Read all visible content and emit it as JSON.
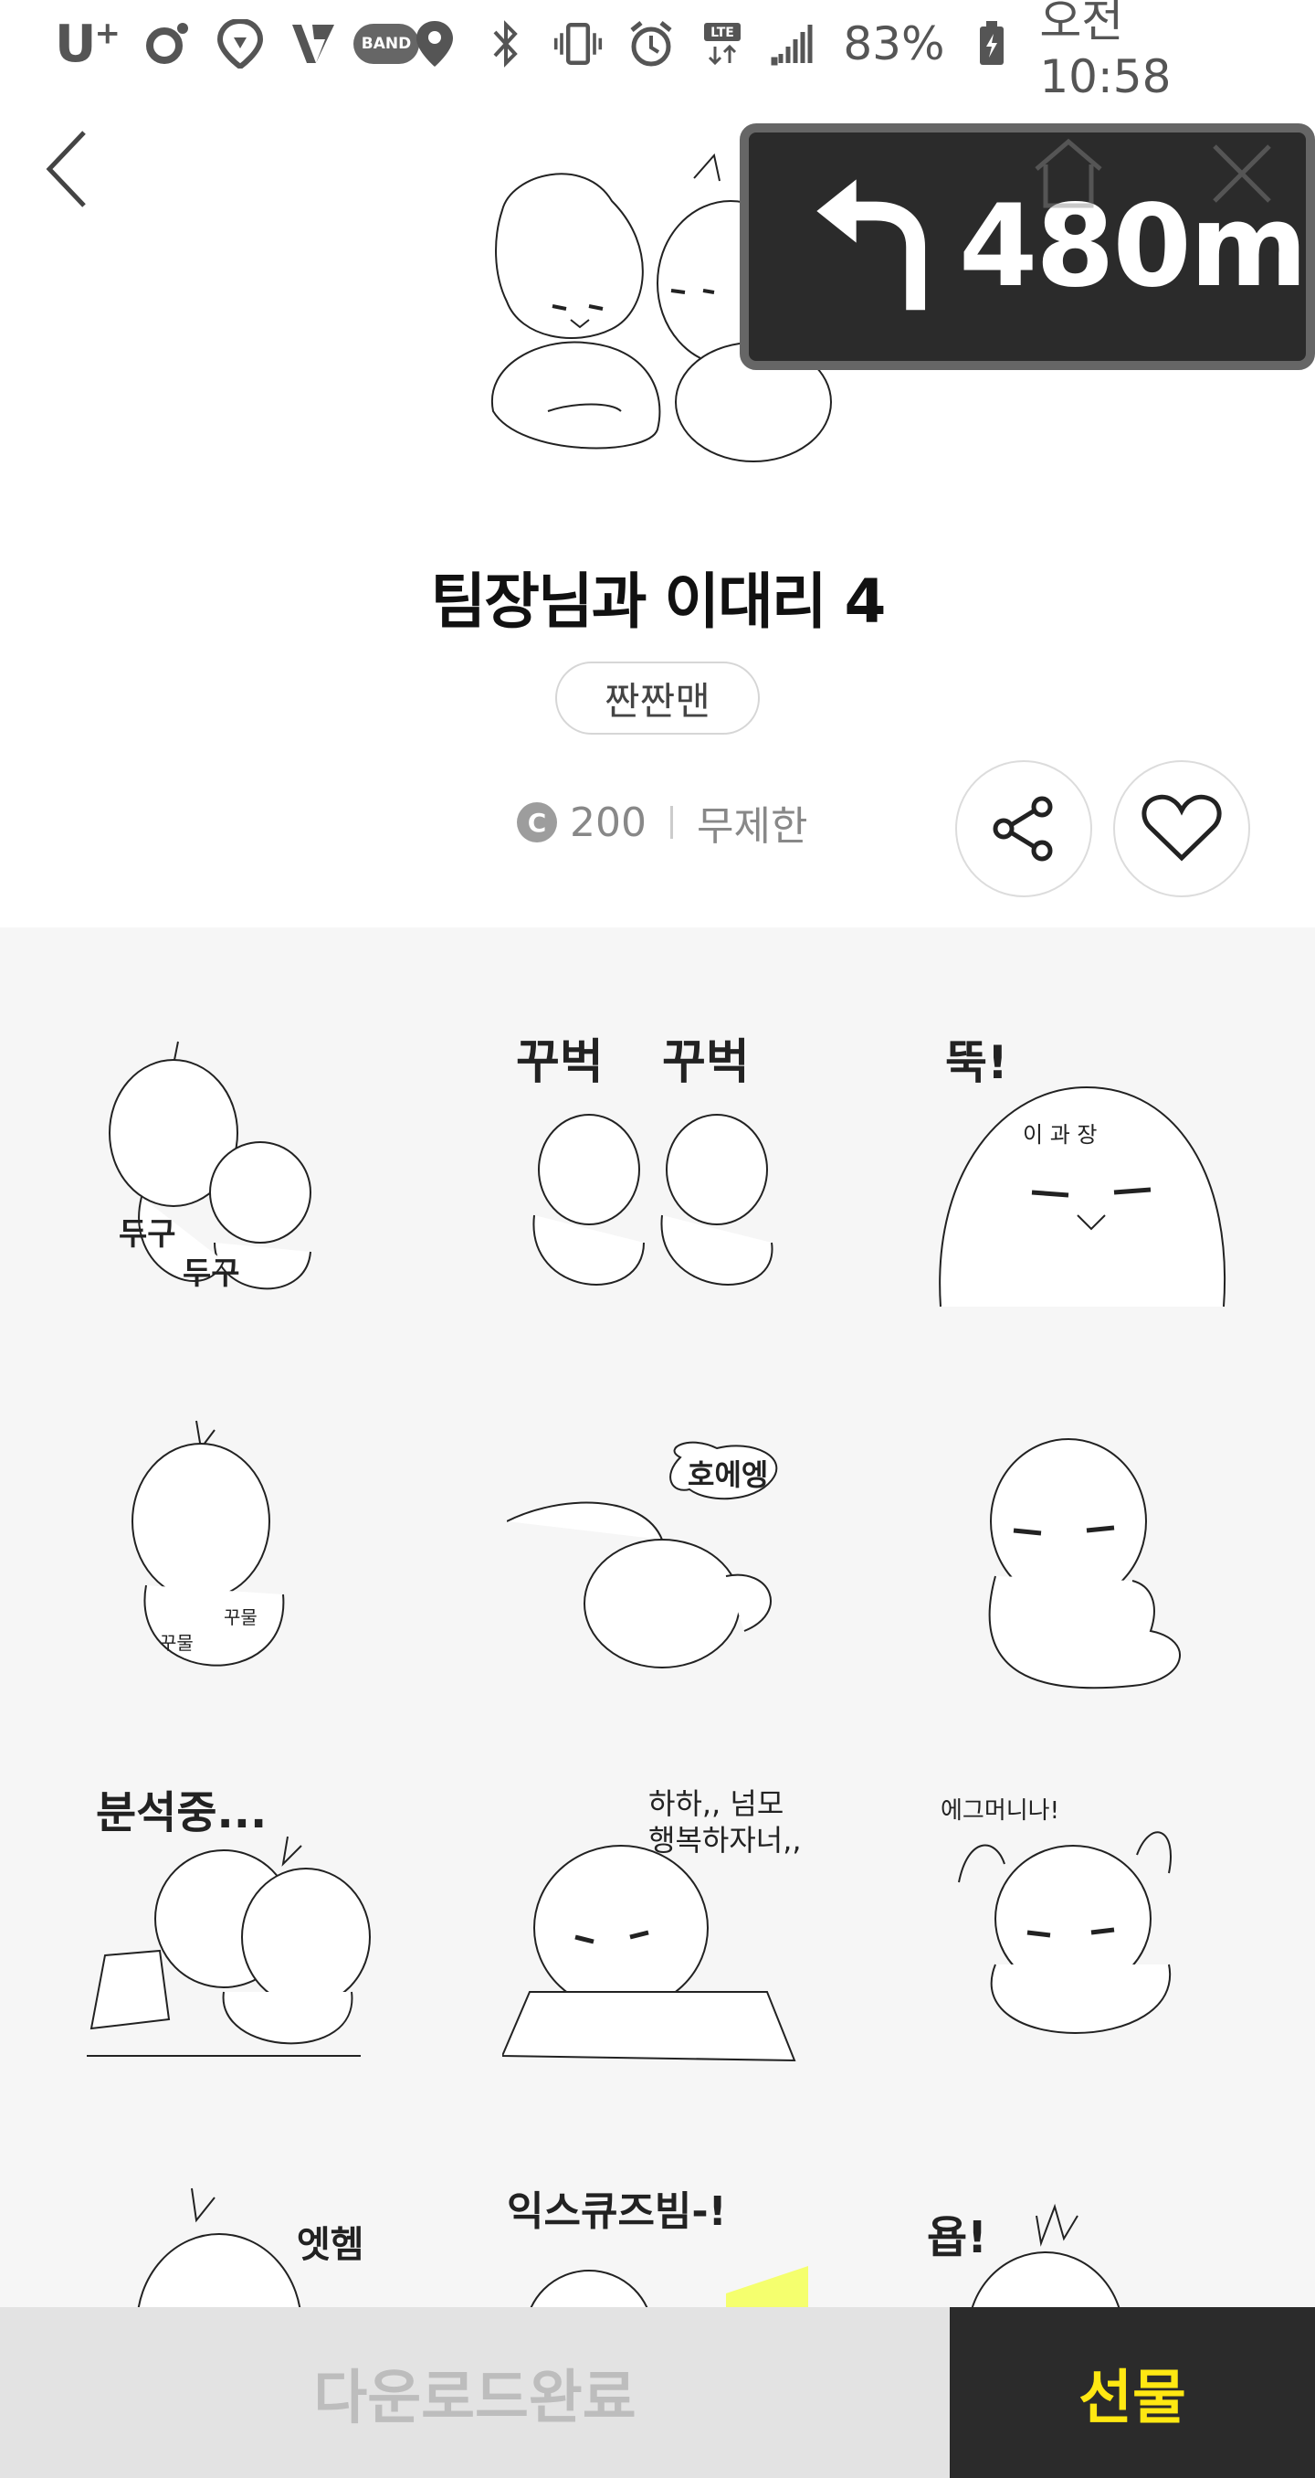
{
  "status_bar": {
    "carrier": "U",
    "carrier_plus": "+",
    "band_label": "BAND",
    "lte_label": "LTE",
    "battery": "83%",
    "time": "오전 10:58"
  },
  "navigation_overlay": {
    "distance": "480m",
    "turn": "left"
  },
  "product": {
    "title": "팀장님과 이대리 4",
    "author": "짠짠맨",
    "coin_symbol": "C",
    "price": "200",
    "duration": "무제한"
  },
  "stickers": {
    "labels": {
      "s1": "두구",
      "s1b": "두구",
      "s2": "꾸벅",
      "s2b": "꾸벅",
      "s3": "뚝!",
      "s3b": "이 과 장",
      "s4": "꾸물",
      "s4b": "꾸물",
      "s5": "호에엥",
      "s7": "분석중...",
      "s8": "하하,, 넘모",
      "s8b": "행복하자너,,",
      "s9": "에그머니나!",
      "s10": "엣헴",
      "s11": "익스큐즈빔-!",
      "s12": "욥!"
    }
  },
  "bottom_bar": {
    "download_label": "다운로드완료",
    "gift_label": "선물"
  },
  "colors": {
    "gift_text": "#ffe812",
    "bottom_dark": "#2b2b2b",
    "grid_bg": "#f6f6f6"
  }
}
